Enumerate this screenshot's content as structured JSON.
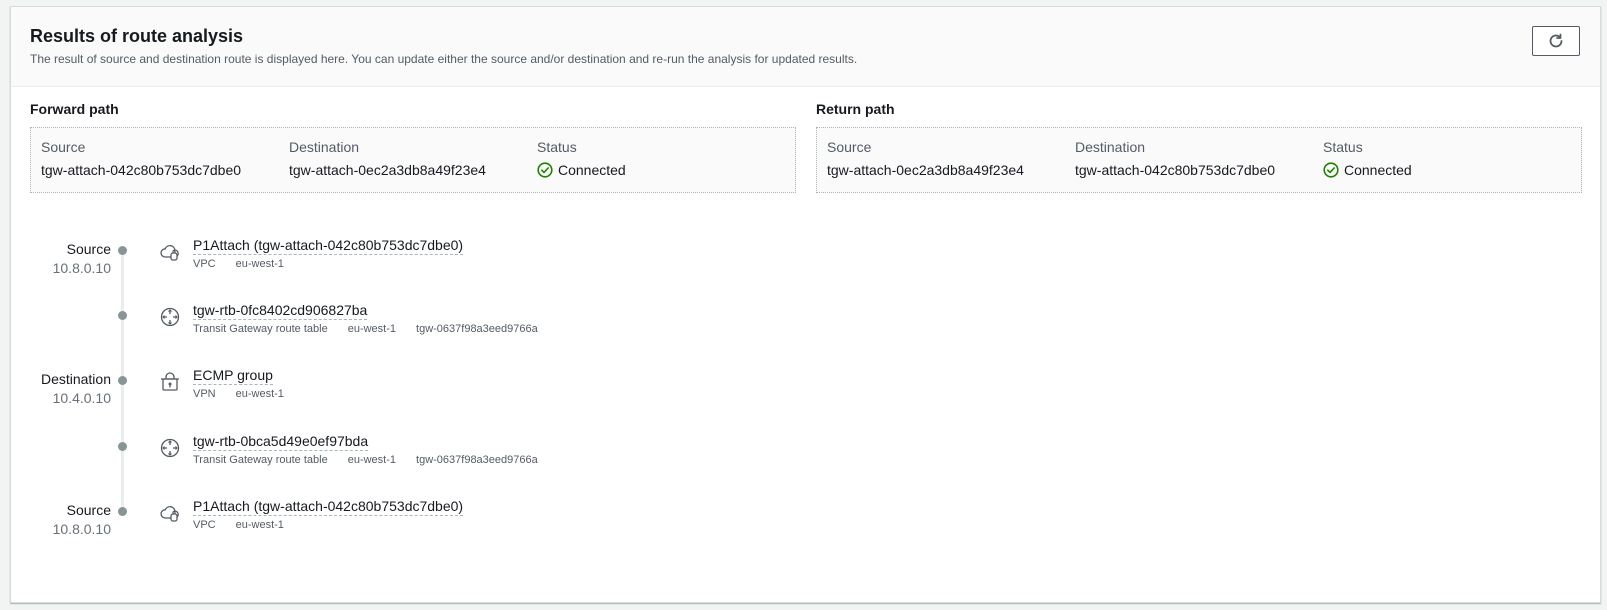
{
  "header": {
    "title": "Results of route analysis",
    "description": "The result of source and destination route is displayed here. You can update either the source and/or destination and re-run the analysis for updated results.",
    "refresh_icon": "refresh-icon"
  },
  "forward": {
    "heading": "Forward path",
    "source_label": "Source",
    "source_value": "tgw-attach-042c80b753dc7dbe0",
    "destination_label": "Destination",
    "destination_value": "tgw-attach-0ec2a3db8a49f23e4",
    "status_label": "Status",
    "status_value": "Connected"
  },
  "return": {
    "heading": "Return path",
    "source_label": "Source",
    "source_value": "tgw-attach-0ec2a3db8a49f23e4",
    "destination_label": "Destination",
    "destination_value": "tgw-attach-042c80b753dc7dbe0",
    "status_label": "Status",
    "status_value": "Connected"
  },
  "colors": {
    "success": "#1d8102",
    "dot": "#879596"
  },
  "steps": [
    {
      "side_name": "Source",
      "side_ip": "10.8.0.10",
      "icon": "vpc-cloud-icon",
      "title": "P1Attach (tgw-attach-042c80b753dc7dbe0)",
      "meta": [
        "VPC",
        "eu-west-1"
      ]
    },
    {
      "side_name": "",
      "side_ip": "",
      "icon": "route-table-icon",
      "title": "tgw-rtb-0fc8402cd906827ba",
      "meta": [
        "Transit Gateway route table",
        "eu-west-1",
        "tgw-0637f98a3eed9766a"
      ]
    },
    {
      "side_name": "Destination",
      "side_ip": "10.4.0.10",
      "icon": "vpn-lock-icon",
      "title": "ECMP group",
      "meta": [
        "VPN",
        "eu-west-1"
      ]
    },
    {
      "side_name": "",
      "side_ip": "",
      "icon": "route-table-icon",
      "title": "tgw-rtb-0bca5d49e0ef97bda",
      "meta": [
        "Transit Gateway route table",
        "eu-west-1",
        "tgw-0637f98a3eed9766a"
      ]
    },
    {
      "side_name": "Source",
      "side_ip": "10.8.0.10",
      "icon": "vpc-cloud-icon",
      "title": "P1Attach (tgw-attach-042c80b753dc7dbe0)",
      "meta": [
        "VPC",
        "eu-west-1"
      ]
    }
  ]
}
